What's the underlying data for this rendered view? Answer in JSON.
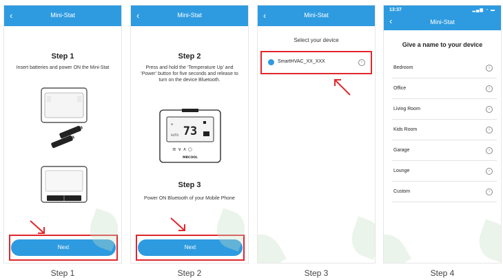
{
  "screens": [
    {
      "header": {
        "title": "Mini-Stat",
        "back_icon": "‹"
      },
      "step_title": "Step 1",
      "description": "Insert batteries and power ON the Mini-Stat",
      "next_label": "Next",
      "caption": "Step 1"
    },
    {
      "header": {
        "title": "Mini-Stat",
        "back_icon": "‹"
      },
      "step_title": "Step 2",
      "description": "Press and hold the ‘Temperature Up’ and ‘Power’ button for five seconds and release to turn on the device Bluetooth.",
      "display": {
        "temperature": "73",
        "brand": "MRCOOL"
      },
      "step3_title": "Step 3",
      "step3_description": "Power ON Bluetooth of your Mobile Phone",
      "next_label": "Next",
      "caption": "Step 2"
    },
    {
      "header": {
        "title": "Mini-Stat",
        "back_icon": "‹"
      },
      "select_title": "Select your device",
      "device_name": "SmartHVAC_XX_XXX",
      "caption": "Step 3"
    },
    {
      "status_bar": {
        "time": "13:37",
        "icons": "▂▄▆ ◔ ▬"
      },
      "header": {
        "title": "Mini-Stat",
        "back_icon": "‹"
      },
      "name_title": "Give a name to your device",
      "names": [
        "Bedroom",
        "Office",
        "Living Room",
        "Kids Room",
        "Garage",
        "Lounge",
        "Custom"
      ],
      "caption": "Step 4"
    }
  ],
  "colors": {
    "brand_blue": "#2e9be0",
    "highlight_red": "#e0262b"
  },
  "icons": {
    "chevron": "›",
    "back": "chevron-left-icon",
    "list_chevron": "chevron-right-circle-icon"
  }
}
